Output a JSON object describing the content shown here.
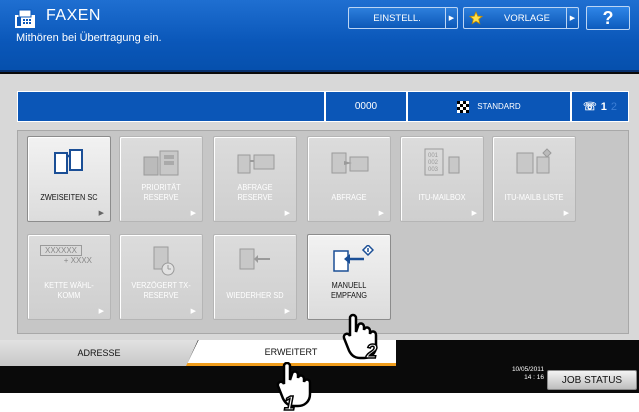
{
  "header": {
    "title": "FAXEN",
    "subtitle": "Mithören bei Übertragung ein.",
    "einstell_label": "EINSTELL.",
    "vorlage_label": "VORLAGE",
    "help_label": "?"
  },
  "status": {
    "count": "0000",
    "mode": "STANDARD",
    "line": "1",
    "line2": "2"
  },
  "tiles": [
    {
      "label": "ZWEISEITEN SC",
      "enabled": true
    },
    {
      "label": "PRIORITÄT RESERVE",
      "enabled": false
    },
    {
      "label": "ABFRAGE RESERVE",
      "enabled": false
    },
    {
      "label": "ABFRAGE",
      "enabled": false
    },
    {
      "label": "ITU-MAILBOX",
      "enabled": false
    },
    {
      "label": "ITU-MAILB LISTE",
      "enabled": false
    },
    {
      "label": "KETTE WÄHL-KOMM",
      "enabled": false,
      "icon_text_top": "XXXXXX",
      "icon_text_bottom": "+ XXXX"
    },
    {
      "label": "VERZÖGERT TX-RESERVE",
      "enabled": false
    },
    {
      "label": "WIEDERHER SD",
      "enabled": false
    },
    {
      "label": "MANUELL EMPFANG",
      "enabled": true
    }
  ],
  "tabs": {
    "adresse": "ADRESSE",
    "erweitert": "ERWEITERT"
  },
  "footer": {
    "date": "10/05/2011",
    "time": "14 : 16",
    "job_status": "JOB STATUS"
  },
  "callouts": {
    "step1": "1",
    "step2": "2"
  }
}
